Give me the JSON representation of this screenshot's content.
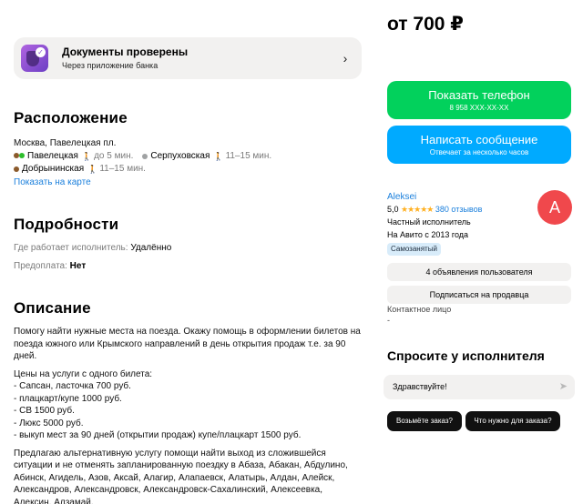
{
  "docs": {
    "title": "Документы проверены",
    "subtitle": "Через приложение банка",
    "icon": "id-verified-icon"
  },
  "location": {
    "heading": "Расположение",
    "address": "Москва, Павелецкая пл.",
    "metro": [
      {
        "name": "Павелецкая",
        "time": "до 5 мин.",
        "colors": [
          "#8b5a2b",
          "#2dbe2c"
        ]
      },
      {
        "name": "Серпуховская",
        "time": "11–15 мин.",
        "colors": [
          "#a0a2a3"
        ]
      },
      {
        "name": "Добрынинская",
        "time": "11–15 мин.",
        "colors": [
          "#8b5a2b"
        ]
      }
    ],
    "map_link": "Показать на карте"
  },
  "details": {
    "heading": "Подробности",
    "work_label": "Где работает исполнитель:",
    "work_value": "Удалённо",
    "prepay_label": "Предоплата:",
    "prepay_value": "Нет"
  },
  "description": {
    "heading": "Описание",
    "p1": "Помогу найти нужные места на поезда. Окажу помощь в оформлении билетов на поезда южного или Крымского направлений в день открытия продаж т.е. за 90 дней.",
    "prices_title": "Цены на услуги с одного билета:",
    "prices": [
      "- Сапсан, ласточка 700 руб.",
      "- плацкарт/купе 1000 руб.",
      "- СВ 1500 руб.",
      "- Люкс 5000 руб.",
      "- выкуп мест за 90 дней (открытии продаж) купе/плацкарт 1500 руб."
    ],
    "p3": "Предлагаю альтернативную услугу помощи найти выход из сложившейся ситуации и не отменять запланированную поездку в Абаза, Абакан, Абдулино, Абинск, Агидель, Азов, Аксай, Алагир, Алапаевск, Алатырь, Алдан, Алейск, Александров, Александровск, Александровск-Сахалинский, Алексеевка, Алексин, Алзамай,"
  },
  "price": "от 700 ₽",
  "phone_button": {
    "label": "Показать телефон",
    "sub": "8 958 XXX-XX-XX"
  },
  "message_button": {
    "label": "Написать сообщение",
    "sub": "Отвечает за несколько часов"
  },
  "seller": {
    "name": "Aleksei",
    "rating": "5,0",
    "stars": "★★★★★",
    "reviews": "380 отзывов",
    "type": "Частный исполнитель",
    "since": "На Авито с 2013 года",
    "avatar_letter": "A",
    "avatar_color": "#f0484c",
    "badge": "Самозанятый",
    "listings_button": "4 объявления пользователя",
    "subscribe_button": "Подписаться на продавца",
    "contact_label": "Контактное лицо",
    "contact_value": "-"
  },
  "ask": {
    "heading": "Спросите у исполнителя",
    "input_value": "Здравствуйте!",
    "chips": [
      "Возьмёте заказ?",
      "Что нужно для заказа?"
    ]
  }
}
